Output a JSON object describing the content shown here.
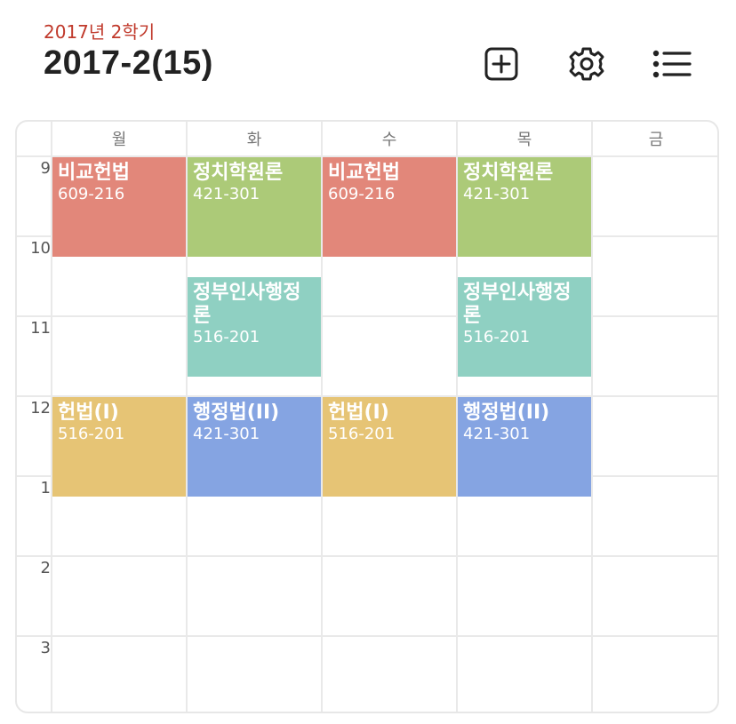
{
  "header": {
    "semester": "2017년 2학기",
    "title": "2017-2(15)",
    "icons": [
      "add-square-icon",
      "gear-icon",
      "list-icon"
    ]
  },
  "timetable": {
    "days": [
      "월",
      "화",
      "수",
      "목",
      "금"
    ],
    "hours": [
      "9",
      "10",
      "11",
      "12",
      "1",
      "2",
      "3"
    ],
    "courses": [
      {
        "name": "비교헌법",
        "room": "609-216",
        "color": "#e2877a"
      },
      {
        "name": "정치학원론",
        "room": "421-301",
        "color": "#acca78"
      },
      {
        "name": "비교헌법",
        "room": "609-216",
        "color": "#e2877a"
      },
      {
        "name": "정치학원론",
        "room": "421-301",
        "color": "#acca78"
      },
      {
        "name": "정부인사행정\n론",
        "room": "516-201",
        "color": "#8fd0c2"
      },
      {
        "name": "정부인사행정\n론",
        "room": "516-201",
        "color": "#8fd0c2"
      },
      {
        "name": "헌법(I)",
        "room": "516-201",
        "color": "#e6c475"
      },
      {
        "name": "행정법(II)",
        "room": "421-301",
        "color": "#85a4e2"
      },
      {
        "name": "헌법(I)",
        "room": "516-201",
        "color": "#e6c475"
      },
      {
        "name": "행정법(II)",
        "room": "421-301",
        "color": "#85a4e2"
      }
    ]
  }
}
